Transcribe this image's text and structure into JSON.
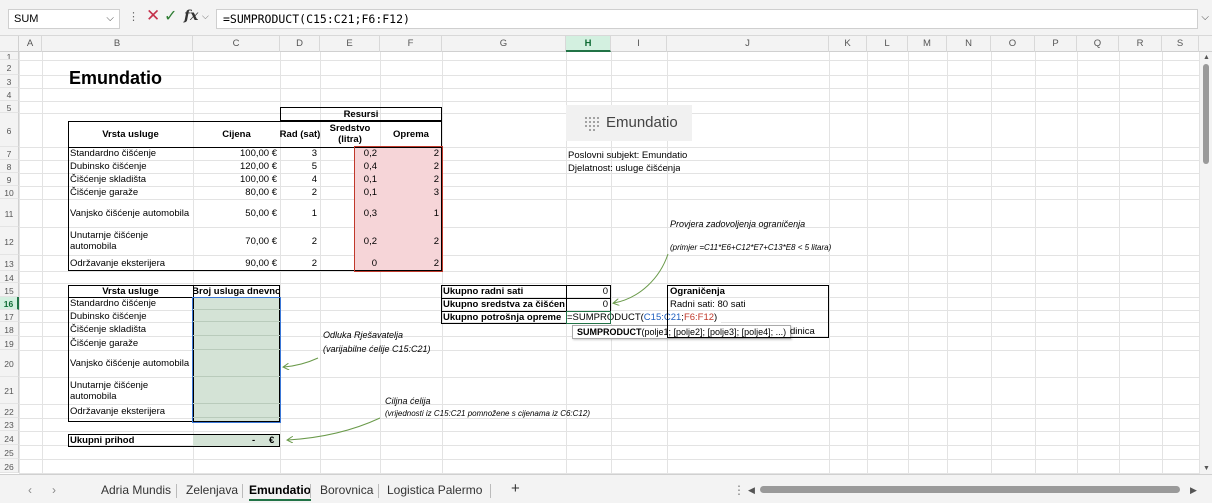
{
  "formula_bar": {
    "name_box": "SUM",
    "fx": "fx",
    "formula": "=SUMPRODUCT(C15:C21;F6:F12)"
  },
  "columns": [
    "A",
    "B",
    "C",
    "D",
    "E",
    "F",
    "G",
    "H",
    "I",
    "J",
    "K",
    "L",
    "M",
    "N",
    "O",
    "P",
    "Q",
    "R",
    "S"
  ],
  "rows": [
    "1",
    "2",
    "3",
    "4",
    "5",
    "6",
    "7",
    "8",
    "9",
    "10",
    "11",
    "12",
    "13",
    "14",
    "15",
    "16",
    "17",
    "18",
    "19",
    "20",
    "21",
    "22",
    "23",
    "24",
    "25",
    "26"
  ],
  "sheet": {
    "title": "Emundatio",
    "top_table": {
      "resursi": "Resursi",
      "headers": {
        "vrsta": "Vrsta usluge",
        "cijena": "Cijena",
        "rad": "Rad (sat)",
        "sredstvo": "Sredstvo (litra)",
        "oprema": "Oprema"
      },
      "rows": [
        {
          "name": "Standardno čišćenje",
          "price": "100,00 €",
          "rad": "3",
          "sred": "0,2",
          "opr": "2"
        },
        {
          "name": "Dubinsko čišćenje",
          "price": "120,00 €",
          "rad": "5",
          "sred": "0,4",
          "opr": "2"
        },
        {
          "name": "Čišćenje skladišta",
          "price": "100,00 €",
          "rad": "4",
          "sred": "0,1",
          "opr": "2"
        },
        {
          "name": "Čišćenje garaže",
          "price": "80,00 €",
          "rad": "2",
          "sred": "0,1",
          "opr": "3"
        },
        {
          "name": "Vanjsko čišćenje automobila",
          "price": "50,00 €",
          "rad": "1",
          "sred": "0,3",
          "opr": "1"
        },
        {
          "name": "Unutarnje čišćenje automobila",
          "price": "70,00 €",
          "rad": "2",
          "sred": "0,2",
          "opr": "2"
        },
        {
          "name": "Održavanje eksterijera",
          "price": "90,00 €",
          "rad": "2",
          "sred": "0",
          "opr": "2"
        }
      ]
    },
    "bottom_table": {
      "headers": {
        "vrsta": "Vrsta usluge",
        "broj": "Broj usluga dnevno"
      },
      "rows": [
        "Standardno čišćenje",
        "Dubinsko čišćenje",
        "Čišćenje skladišta",
        "Čišćenje garaže",
        "Vanjsko čišćenje automobila",
        "Unutarnje čišćenje automobila",
        "Održavanje eksterijera"
      ]
    },
    "revenue": {
      "label": "Ukupni prihod",
      "value": "-",
      "currency": "€"
    },
    "logo_text": "Emundatio",
    "info": {
      "line1": "Poslovni subjekt: Emundatio",
      "line2": "Djelatnost: usluge čišćenja"
    },
    "totals": [
      {
        "label": "Ukupno radni sati",
        "value": "0"
      },
      {
        "label": "Ukupno sredstva za čišćenje",
        "value": "0"
      },
      {
        "label": "Ukupno potrošnja opreme",
        "value": "=SUMPRODUCT("
      }
    ],
    "formula_parts": {
      "range1": "C15:C21",
      "sep": ";",
      "range2": "F6:F12",
      "end": ")"
    },
    "constraints": {
      "header": "Ograničenja",
      "line1": "Radni sati: 80 sati",
      "line2": "dinica"
    },
    "tooltip": {
      "fn": "SUMPRODUCT",
      "args": "(polje1; [polje2]; [polje3]; [polje4]; ...)"
    },
    "notes": {
      "provjera": "Provjera zadovoljenja ograničenja",
      "primjer": "(primjer =C11*E6+C12*E7+C13*E8 < 5 litara)",
      "odluka": "Odluka Rješavatelja",
      "varijabilne": "(varijabilne ćelije C15:C21)",
      "ciljna": "Ciljna ćelija",
      "vrijednosti": "(vrijednosti iz C15:C21 pomnožene s cijenama iz C6:C12)"
    }
  },
  "tabs": [
    "Adria Mundis",
    "Zelenjava",
    "Emundatio",
    "Borovnica",
    "Logistica Palermo"
  ],
  "active_tab": "Emundatio",
  "colors": {
    "accent": "#217346",
    "pink": "#f6d5d8",
    "green": "#d4e3d6",
    "red_border": "#c0392b",
    "blue_border": "#3b78d8"
  }
}
